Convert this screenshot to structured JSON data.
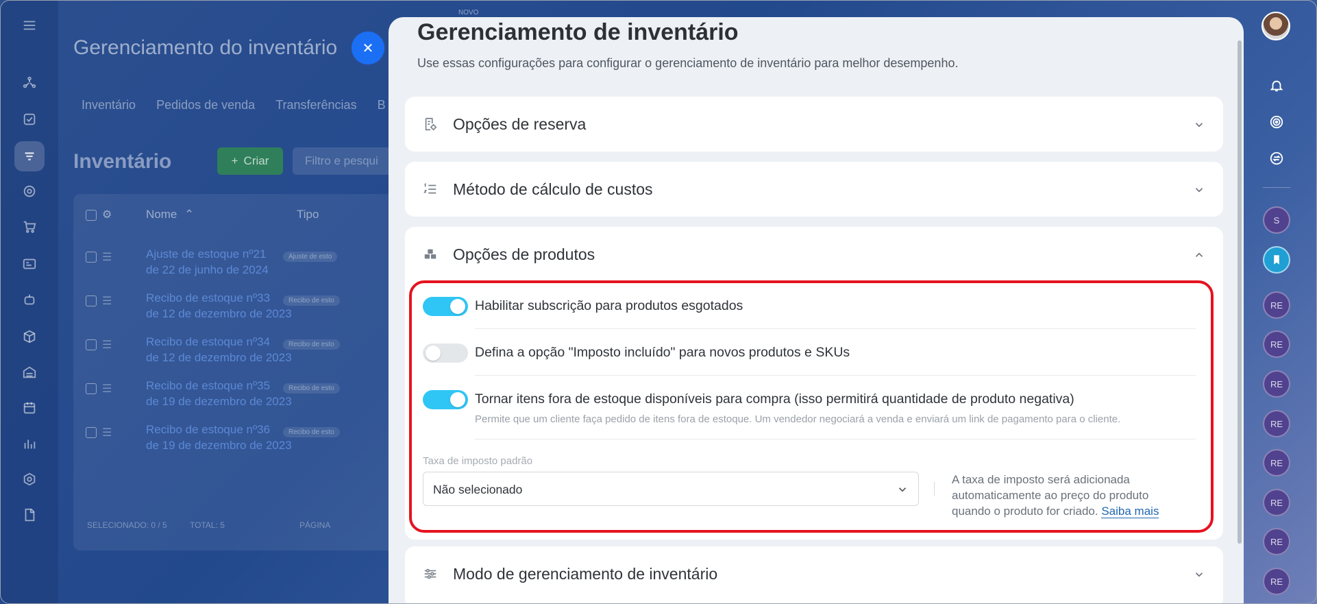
{
  "background_app": {
    "new_badge": "NOVO",
    "title": "Gerenciamento do inventário",
    "tabs": [
      "Inventário",
      "Pedidos de venda",
      "Transferências",
      "B"
    ],
    "heading": "Inventário",
    "create_button": "Criar",
    "filter_placeholder": "Filtro e pesqui",
    "columns": {
      "name": "Nome",
      "type": "Tipo"
    },
    "rows": [
      {
        "line1": "Ajuste de estoque nº21",
        "line2": "de 22 de junho de 2024",
        "type": "Ajuste de esto"
      },
      {
        "line1": "Recibo de estoque nº33",
        "line2": "de 12 de dezembro de 2023",
        "type": "Recibo de esto"
      },
      {
        "line1": "Recibo de estoque nº34",
        "line2": "de 12 de dezembro de 2023",
        "type": "Recibo de esto"
      },
      {
        "line1": "Recibo de estoque nº35",
        "line2": "de 19 de dezembro de 2023",
        "type": "Recibo de esto"
      },
      {
        "line1": "Recibo de estoque nº36",
        "line2": "de 19 de dezembro de 2023",
        "type": "Recibo de esto"
      }
    ],
    "footer": {
      "selected": "SELECIONADO: 0 / 5",
      "total": "TOTAL: 5",
      "page": "PÁGINA"
    }
  },
  "panel": {
    "title": "Gerenciamento de inventário",
    "subtitle": "Use essas configurações para configurar o gerenciamento de inventário para melhor desempenho.",
    "sections": {
      "reserve": "Opções de reserva",
      "cost": "Método de cálculo de custos",
      "products": "Opções de produtos",
      "mode": "Modo de gerenciamento de inventário"
    },
    "product_options": {
      "opt1": {
        "label": "Habilitar subscrição para produtos esgotados",
        "enabled": true
      },
      "opt2": {
        "label": "Defina a opção \"Imposto incluído\" para novos produtos e SKUs",
        "enabled": false
      },
      "opt3": {
        "label": "Tornar itens fora de estoque disponíveis para compra (isso permitirá quantidade de produto negativa)",
        "description": "Permite que um cliente faça pedido de itens fora de estoque. Um vendedor negociará a venda e enviará um link de pagamento para o cliente.",
        "enabled": true
      },
      "tax_label": "Taxa de imposto padrão",
      "tax_value": "Não selecionado",
      "tax_help": "A taxa de imposto será adicionada automaticamente ao preço do produto quando o produto for criado.",
      "tax_help_link": "Saiba mais"
    }
  },
  "right_rail": {
    "avatars": [
      "S",
      "RE",
      "RE",
      "RE",
      "RE",
      "RE",
      "RE",
      "RE",
      "RE"
    ]
  },
  "colors": {
    "toggle_on": "#2fc6f6",
    "highlight": "#e5131f",
    "link": "#2067b0",
    "accent": "#1b6ff5"
  }
}
